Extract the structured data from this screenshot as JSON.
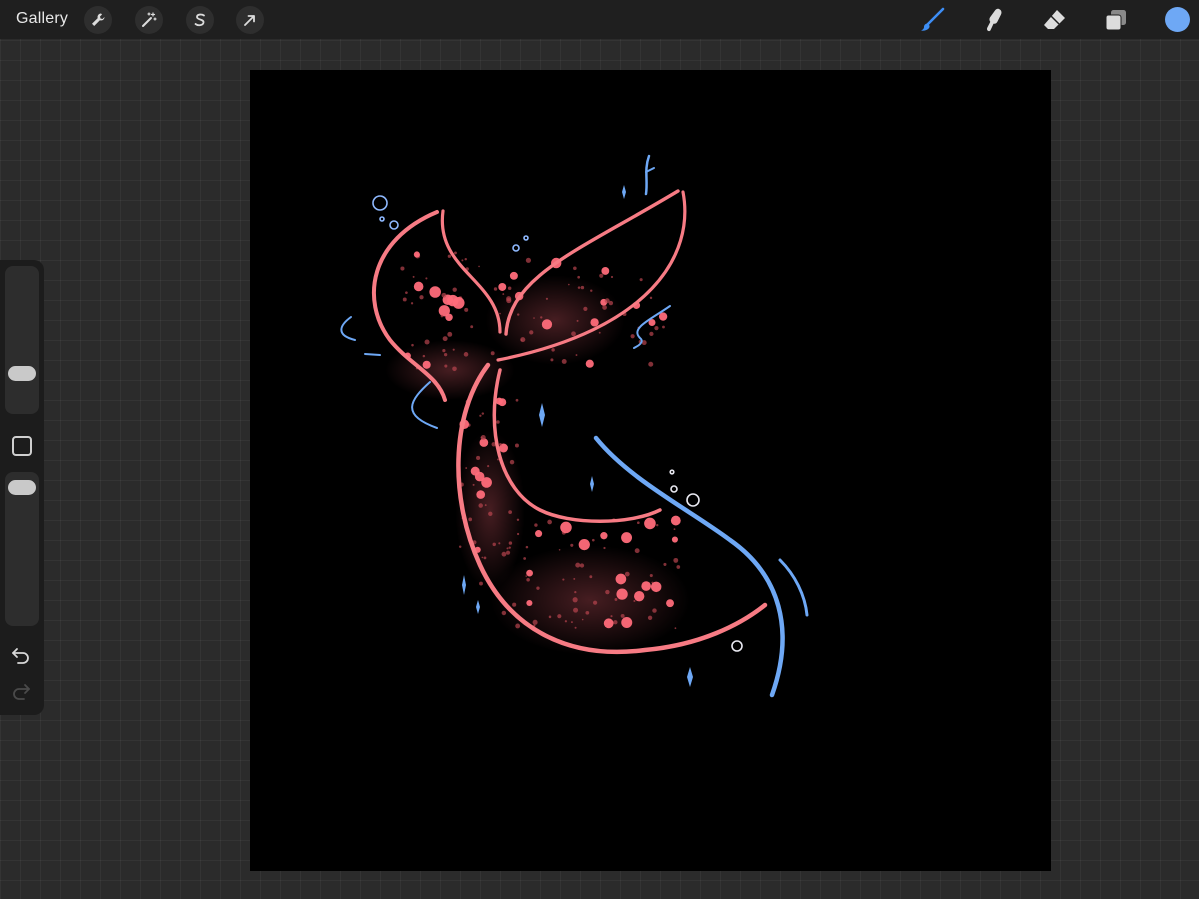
{
  "topbar": {
    "gallery_label": "Gallery",
    "left_tools": [
      {
        "name": "actions",
        "icon": "wrench-icon"
      },
      {
        "name": "adjustments",
        "icon": "magic-wand-icon"
      },
      {
        "name": "selection",
        "icon": "selection-s-icon"
      },
      {
        "name": "transform",
        "icon": "arrow-cursor-icon"
      }
    ],
    "right_tools": [
      {
        "name": "brush",
        "icon": "brush-icon",
        "active": true
      },
      {
        "name": "smudge",
        "icon": "smudge-finger-icon",
        "active": false
      },
      {
        "name": "eraser",
        "icon": "eraser-icon",
        "active": false
      },
      {
        "name": "layers",
        "icon": "layers-icon",
        "active": false
      }
    ],
    "current_color": "#6ea8f5"
  },
  "sidebar": {
    "brush_size_icon": "brush-size-slider",
    "brush_opacity_icon": "brush-opacity-slider",
    "modify_icon": "modify-square-icon",
    "undo_icon": "undo-icon",
    "redo_icon": "redo-icon"
  },
  "canvas": {
    "background": "#000000",
    "artwork": "mermaid-tail-drawing",
    "colors": {
      "tail_outline": "#f77b84",
      "water_lines": "#6ea8f5",
      "bubbles": "#e8e8f0",
      "glitter": "#ff6b7a"
    }
  },
  "theme": {
    "accent_blue": "#3d8ef5",
    "topbar_bg": "#1f1f1f",
    "workspace_bg": "#2b2b2b"
  }
}
